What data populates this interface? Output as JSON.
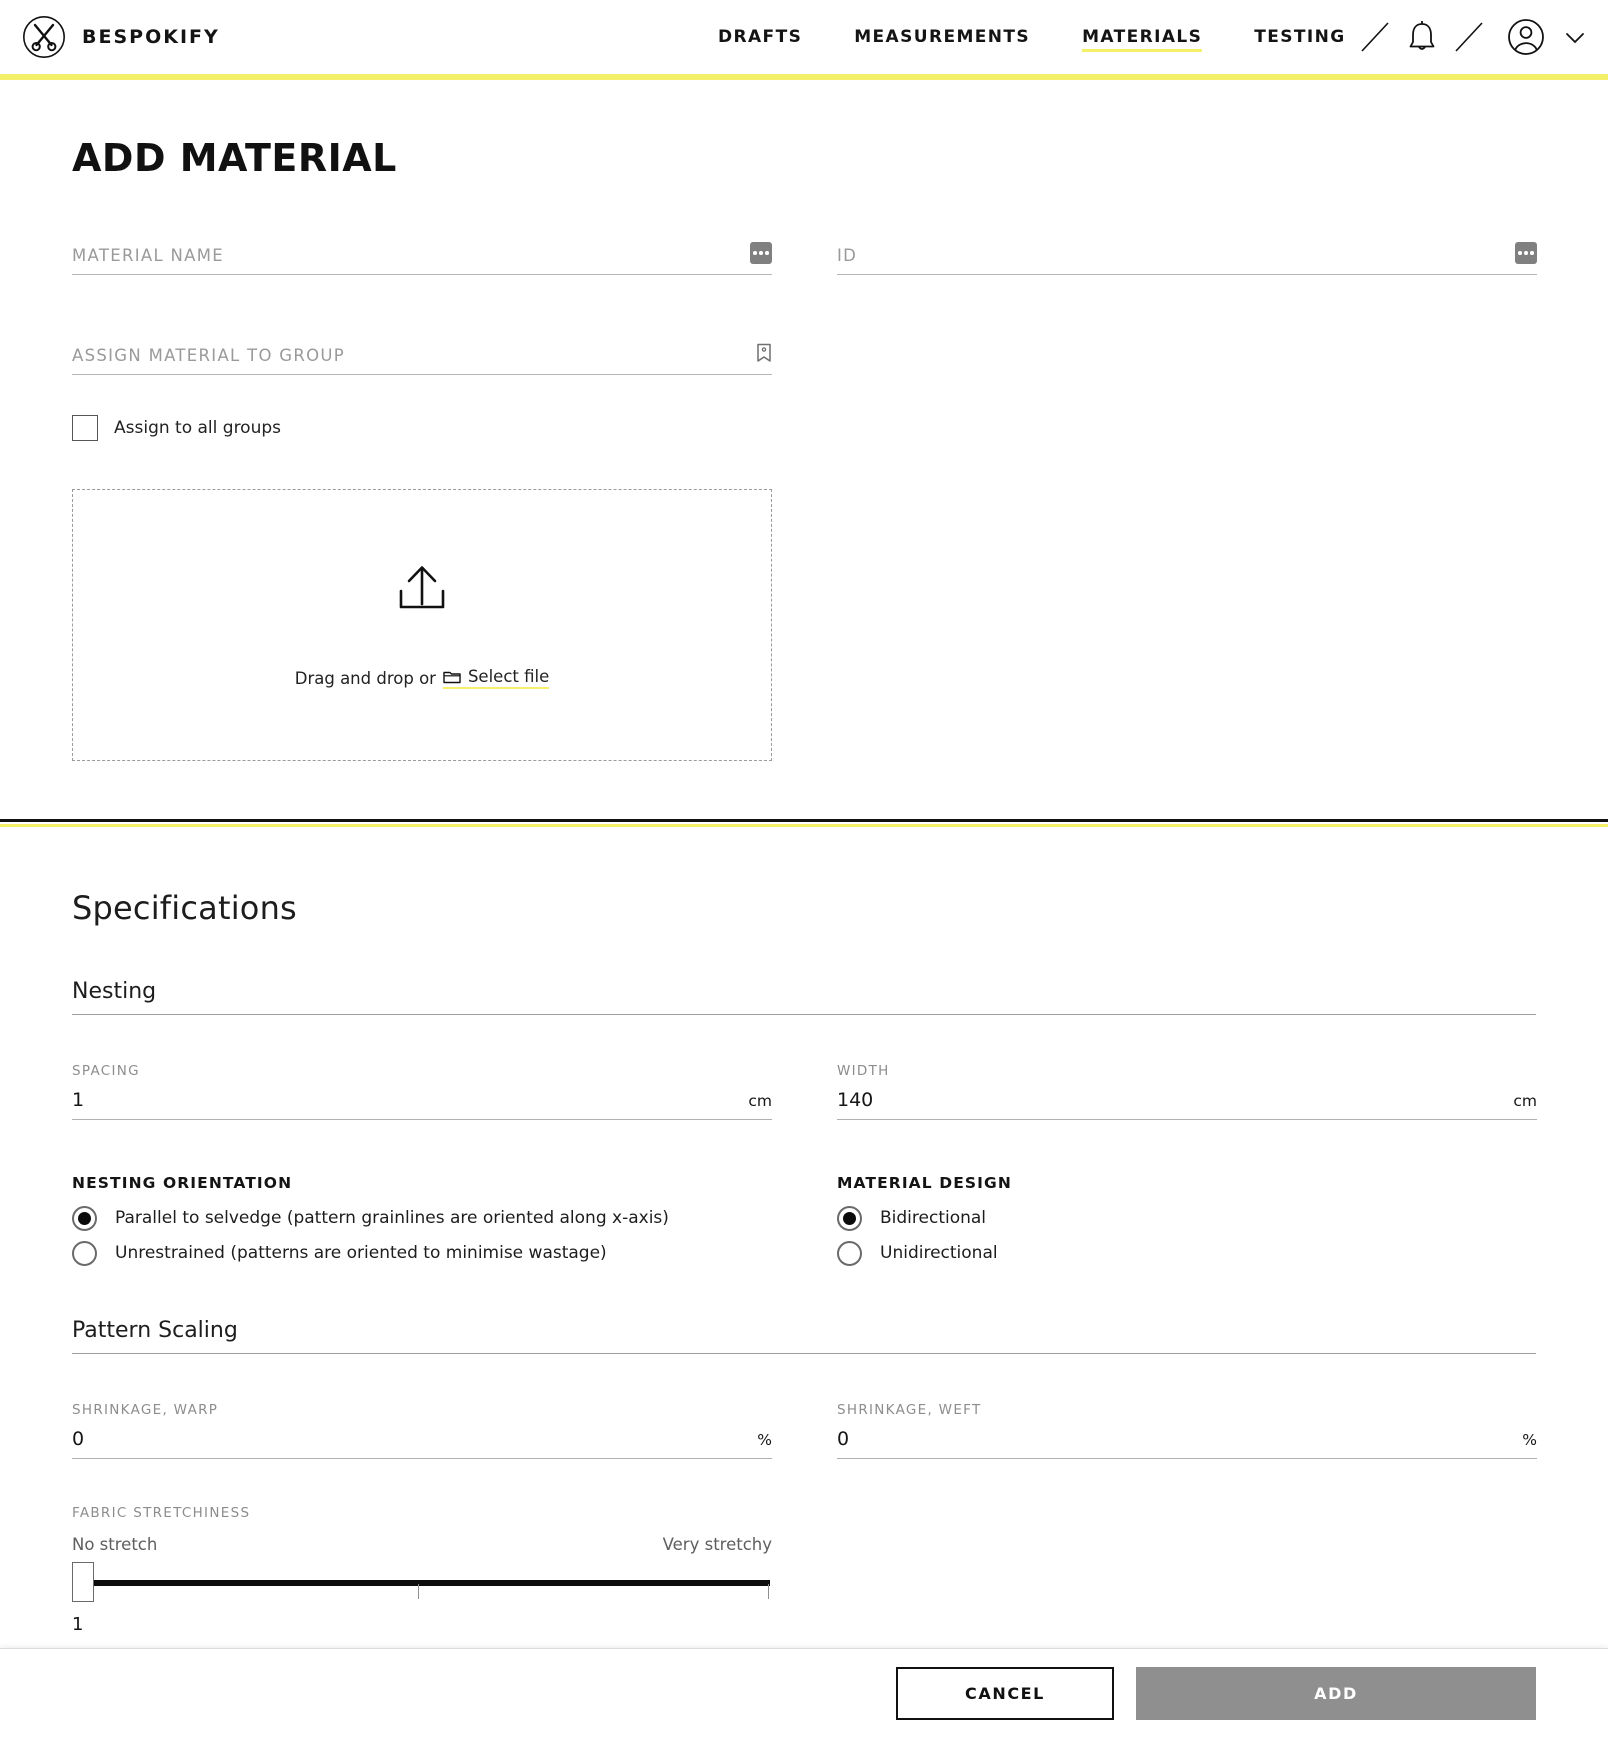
{
  "header": {
    "brand": "BESPOKIFY",
    "logo_icon": "scissors-icon",
    "nav": [
      {
        "label": "DRAFTS",
        "active": false
      },
      {
        "label": "MEASUREMENTS",
        "active": false
      },
      {
        "label": "MATERIALS",
        "active": true
      },
      {
        "label": "TESTING",
        "active": false
      }
    ],
    "icons": [
      "bell-icon",
      "user-avatar-icon",
      "chevron-down-icon"
    ],
    "accent_color": "#f5f06a"
  },
  "page": {
    "title": "ADD MATERIAL"
  },
  "form": {
    "material_name": {
      "label": "MATERIAL NAME",
      "value": "",
      "icon": "ellipsis-icon"
    },
    "id": {
      "label": "ID",
      "value": "",
      "icon": "ellipsis-icon"
    },
    "group": {
      "label": "ASSIGN MATERIAL TO GROUP",
      "value": "",
      "icon": "tag-icon"
    },
    "assign_all": {
      "label": "Assign to all groups",
      "checked": false
    },
    "dropzone": {
      "icon": "upload-icon",
      "text": "Drag and drop or",
      "link": "Select file",
      "link_icon": "folder-icon"
    }
  },
  "specifications": {
    "title": "Specifications",
    "nesting": {
      "heading": "Nesting",
      "spacing": {
        "label": "SPACING",
        "value": "1",
        "unit": "cm"
      },
      "width": {
        "label": "WIDTH",
        "value": "140",
        "unit": "cm"
      },
      "orientation": {
        "label": "NESTING ORIENTATION",
        "options": [
          {
            "label": "Parallel to selvedge (pattern grainlines are oriented along x-axis)",
            "selected": true
          },
          {
            "label": "Unrestrained (patterns are oriented to minimise wastage)",
            "selected": false
          }
        ]
      },
      "design": {
        "label": "MATERIAL DESIGN",
        "options": [
          {
            "label": "Bidirectional",
            "selected": true
          },
          {
            "label": "Unidirectional",
            "selected": false
          }
        ]
      }
    },
    "pattern_scaling": {
      "heading": "Pattern Scaling",
      "shrinkage_warp": {
        "label": "SHRINKAGE, WARP",
        "value": "0",
        "unit": "%"
      },
      "shrinkage_weft": {
        "label": "SHRINKAGE, WEFT",
        "value": "0",
        "unit": "%"
      },
      "stretchiness": {
        "label": "FABRIC STRETCHINESS",
        "min_label": "No stretch",
        "max_label": "Very stretchy",
        "value": "1"
      }
    }
  },
  "footer": {
    "cancel": "CANCEL",
    "add": "ADD"
  }
}
